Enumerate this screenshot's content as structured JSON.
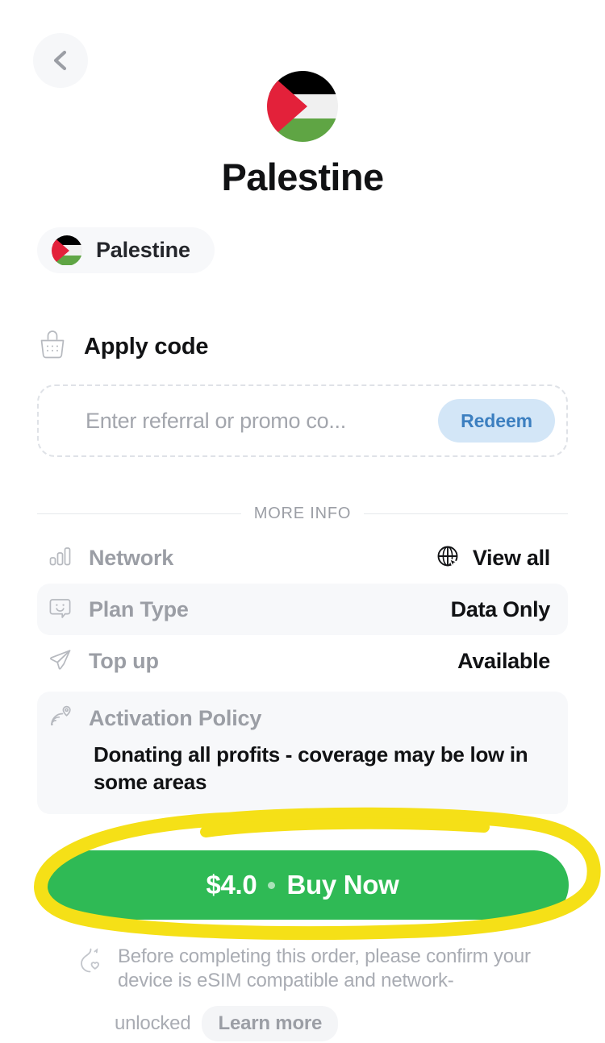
{
  "header": {
    "back_icon": "chevron-left-icon",
    "flag_icon": "palestine-flag-icon",
    "title": "Palestine"
  },
  "country_chip": {
    "flag_icon": "palestine-flag-icon",
    "label": "Palestine"
  },
  "apply_code": {
    "icon": "shopping-basket-icon",
    "heading": "Apply code",
    "input_value": "",
    "input_placeholder": "Enter referral or promo co...",
    "redeem_label": "Redeem"
  },
  "more_info": {
    "divider_label": "MORE INFO",
    "rows": [
      {
        "icon": "signal-bars-icon",
        "label": "Network",
        "value": "View all",
        "value_icon": "globe-cursor-icon",
        "shaded": false,
        "interactable": true
      },
      {
        "icon": "chat-smiley-icon",
        "label": "Plan Type",
        "value": "Data Only",
        "value_icon": "",
        "shaded": true,
        "interactable": false
      },
      {
        "icon": "paper-plane-icon",
        "label": "Top up",
        "value": "Available",
        "value_icon": "",
        "shaded": false,
        "interactable": false
      }
    ],
    "policy": {
      "icon": "radar-pin-icon",
      "label": "Activation Policy",
      "text": "Donating all profits - coverage may be low in some areas"
    }
  },
  "buy": {
    "price": "$4.0",
    "separator": "•",
    "action_label": "Buy Now",
    "full_label": "$4.0 • Buy Now"
  },
  "footer": {
    "icon": "flame-heart-icon",
    "text": "Before completing this order, please confirm your device is eSIM compatible and network-",
    "text_tail": "unlocked",
    "learn_more_label": "Learn more"
  },
  "colors": {
    "brand_green": "#2fba55",
    "annotation_yellow": "#f5e017",
    "redeem_bg": "#d3e6f7",
    "redeem_text": "#3c7fc0",
    "row_shade": "#f7f8fa",
    "muted_text": "#9b9ea5",
    "flag_black": "#000000",
    "flag_white": "#f0f0f0",
    "flag_green": "#5fa544",
    "flag_red": "#e3213a"
  }
}
